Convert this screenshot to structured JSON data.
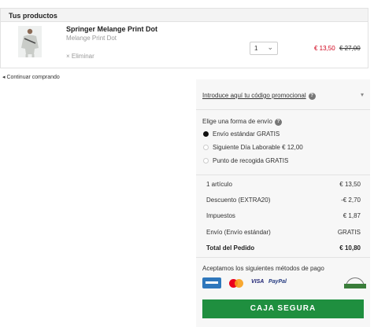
{
  "cart": {
    "header": "Tus productos",
    "item": {
      "name": "Springer Melange Print Dot",
      "variant": "Melange Print Dot",
      "remove_label": "× Eliminar",
      "quantity": "1",
      "price_sale": "€ 13,50",
      "price_original": "€ 27,00"
    }
  },
  "continue_label": "Continuar comprando",
  "promo": {
    "label": "Introduce aquí tu código promocional",
    "help_icon": "?"
  },
  "shipping": {
    "title": "Elige una forma de envío",
    "help_icon": "?",
    "options": [
      {
        "label": "Envío estándar GRATIS",
        "selected": true
      },
      {
        "label": "Siguiente Día Laborable € 12,00",
        "selected": false
      },
      {
        "label": "Punto de recogida GRATIS",
        "selected": false
      }
    ]
  },
  "summary": {
    "rows": [
      {
        "label": "1 artículo",
        "value": "€ 13,50"
      },
      {
        "label": "Descuento (EXTRA20)",
        "value": "-€ 2,70"
      },
      {
        "label": "Impuestos",
        "value": "€ 1,87"
      },
      {
        "label": "Envío (Envío estándar)",
        "value": "GRATIS"
      }
    ],
    "total_label": "Total del Pedido",
    "total_value": "€ 10,80"
  },
  "payment": {
    "title": "Aceptamos los siguientes métodos de pago",
    "visa": "VISA",
    "paypal": "PayPal"
  },
  "checkout_label": "CAJA SEGURA",
  "colors": {
    "sale_price": "#d0021b",
    "checkout_button": "#1f8f3f",
    "panel_background": "#f7f7f7"
  }
}
